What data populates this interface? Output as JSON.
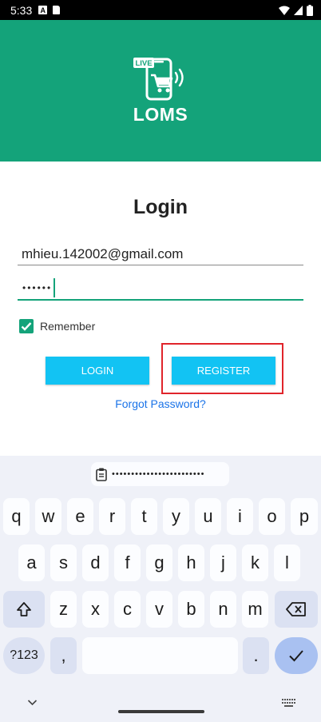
{
  "status_bar": {
    "time": "5:33",
    "a_badge": "A"
  },
  "header": {
    "logo_badge": "LIVE",
    "app_name": "LOMS",
    "bg_color": "#14a37a"
  },
  "form": {
    "title": "Login",
    "email_value": "mhieu.142002@gmail.com",
    "password_masked": "••••••",
    "remember_label": "Remember",
    "remember_checked": true,
    "login_label": "LOGIN",
    "register_label": "REGISTER",
    "forgot_label": "Forgot Password?",
    "button_color": "#12c3f3",
    "highlight_color": "#e0242b"
  },
  "keyboard": {
    "clipboard_text": "••••••••••••••••••••••••",
    "row1": [
      "q",
      "w",
      "e",
      "r",
      "t",
      "y",
      "u",
      "i",
      "o",
      "p"
    ],
    "row2": [
      "a",
      "s",
      "d",
      "f",
      "g",
      "h",
      "j",
      "k",
      "l"
    ],
    "row3": [
      "z",
      "x",
      "c",
      "v",
      "b",
      "n",
      "m"
    ],
    "symbols_label": "?123",
    "comma": ",",
    "period": "."
  }
}
